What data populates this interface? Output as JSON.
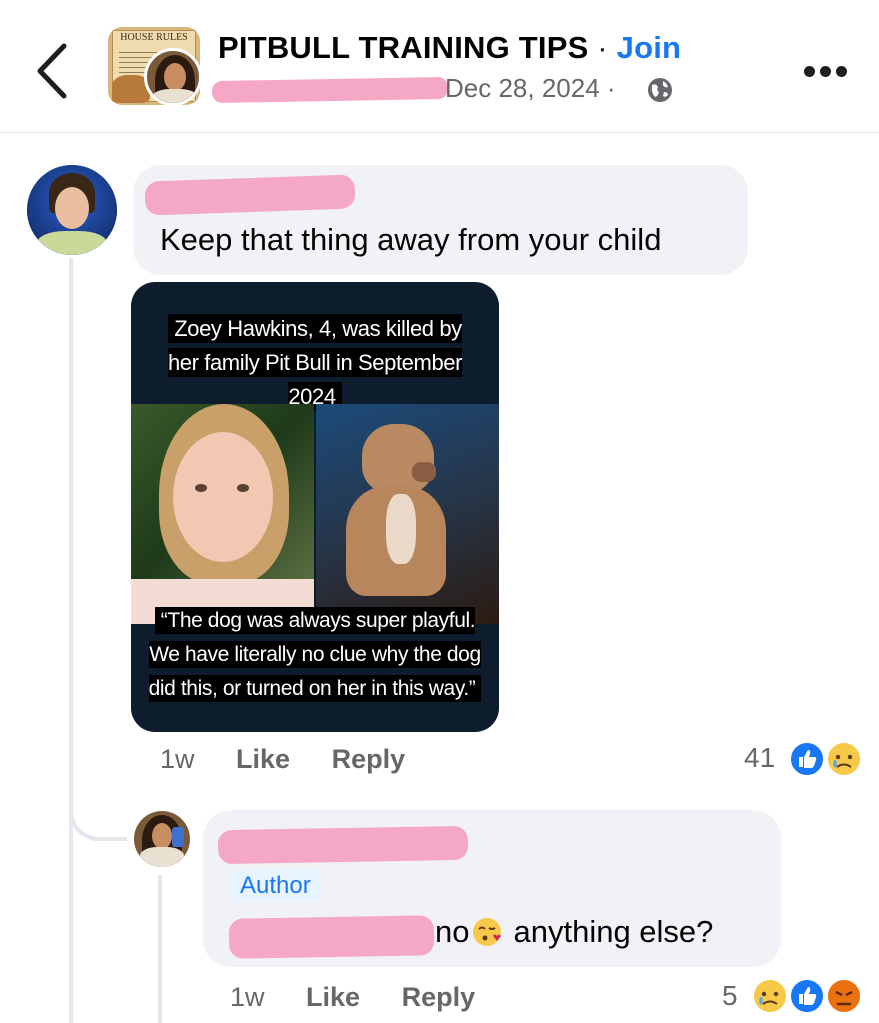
{
  "header": {
    "group_name": "PITBULL TRAINING TIPS",
    "separator": "·",
    "join_label": "Join",
    "post_date": "Dec 28, 2024 ·",
    "group_thumb_sign": "HOUSE RULES",
    "icons": {
      "back": "chevron-left-icon",
      "privacy": "globe-icon",
      "more": "more-horizontal-icon"
    }
  },
  "comment": {
    "text": "Keep that thing away from your child",
    "attachment": {
      "caption_top": "Zoey Hawkins, 4, was killed by her family Pit Bull in September 2024",
      "caption_bottom": "“The dog was always super playful. We have literally no clue why the dog did this, or turned on her in this way.”"
    },
    "time": "1w",
    "like_label": "Like",
    "reply_label": "Reply",
    "reaction_count": "41",
    "reactions": [
      "like",
      "sad"
    ]
  },
  "reply": {
    "author_badge": "Author",
    "text_before_emoji": "no",
    "emoji": "kissing-face-emoji",
    "text_after_emoji": "anything else?",
    "time": "1w",
    "like_label": "Like",
    "reply_label": "Reply",
    "reaction_count": "5",
    "reactions": [
      "sad",
      "like",
      "angry"
    ]
  },
  "colors": {
    "accent": "#1877f2",
    "bubble": "#f0f2f5",
    "secondary_text": "#65676b",
    "redaction": "#f5a7c6"
  }
}
